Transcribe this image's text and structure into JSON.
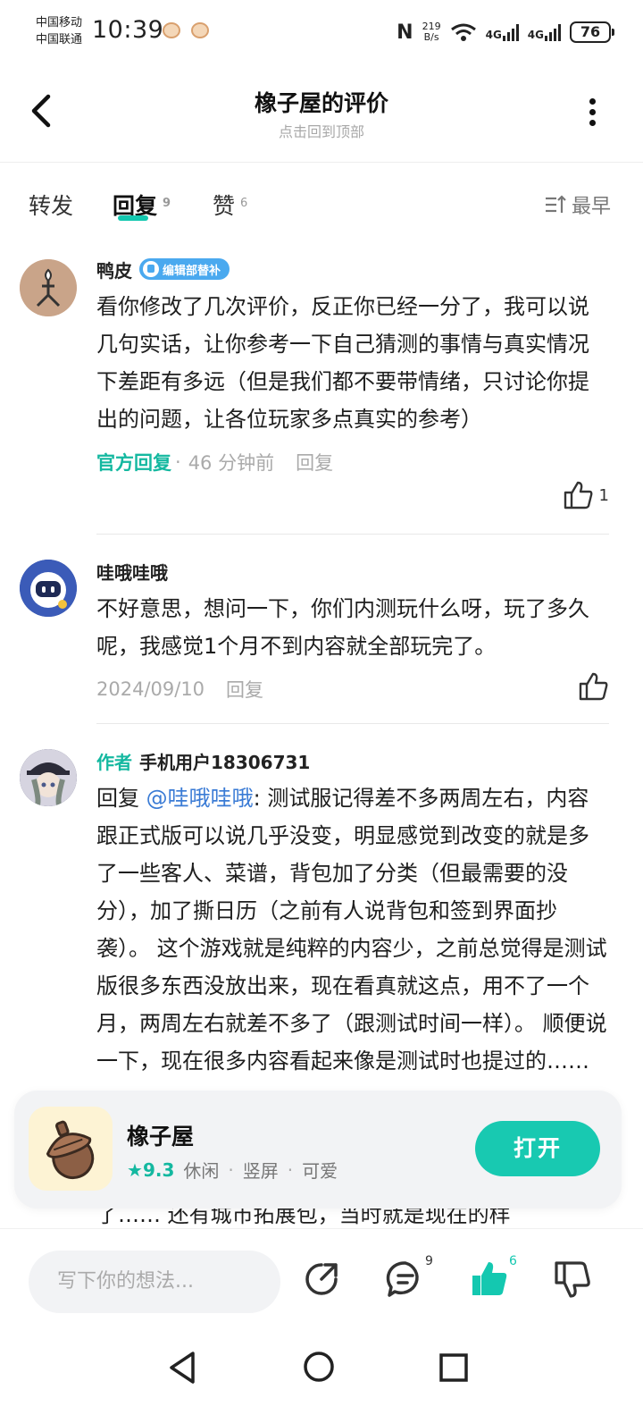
{
  "status_bar": {
    "carrier1": "中国移动",
    "carrier2": "中国联通",
    "time": "10:39",
    "speed_value": "219",
    "speed_unit": "B/s",
    "net1": "4G",
    "net2": "4G",
    "battery": "76"
  },
  "header": {
    "title": "橡子屋的评价",
    "subtitle": "点击回到顶部"
  },
  "tabs": [
    {
      "label": "转发",
      "count": ""
    },
    {
      "label": "回复",
      "count": "9"
    },
    {
      "label": "赞",
      "count": "6"
    }
  ],
  "sort_label": "最早",
  "comments": [
    {
      "name": "鸭皮",
      "badge": "编辑部替补",
      "text": "看你修改了几次评价，反正你已经一分了，我可以说几句实话，让你参考一下自己猜测的事情与真实情况下差距有多远（但是我们都不要带情绪，只讨论你提出的问题，让各位玩家多点真实的参考）",
      "official": "官方回复",
      "time": "46 分钟前",
      "reply": "回复",
      "likes": "1"
    },
    {
      "name": "哇哦哇哦",
      "text": "不好意思，想问一下，你们内测玩什么呀，玩了多久呢，我感觉1个月不到内容就全部玩完了。",
      "time": "2024/09/10",
      "reply": "回复"
    },
    {
      "author_tag": "作者",
      "name": "手机用户18306731",
      "reply_prefix": "回复 ",
      "mention": "@哇哦哇哦",
      "text": ": 测试服记得差不多两周左右，内容跟正式版可以说几乎没变，明显感觉到改变的就是多了一些客人、菜谱，背包加了分类（但最需要的没分），加了撕日历（之前有人说背包和签到界面抄袭）。 这个游戏就是纯粹的内容少，之前总觉得是测试版很多东西没放出来，现在看真就这点，用不了一个月，两周左右就差不多了（跟测试时间一样）。 顺便说一下，现在很多内容看起来像是测试时也提过的……"
    }
  ],
  "peek_text": "了…… 还有城市拓展包，当时就是现在的样",
  "app_card": {
    "name": "橡子屋",
    "score": "9.3",
    "tags": [
      "休闲",
      "竖屏",
      "可爱"
    ],
    "open_label": "打开"
  },
  "bottom_bar": {
    "placeholder": "写下你的想法...",
    "reply_count": "9",
    "like_count": "6"
  },
  "colors": {
    "accent": "#14c8b0",
    "badge": "#4aa9ef",
    "mention": "#3a7bd5"
  }
}
